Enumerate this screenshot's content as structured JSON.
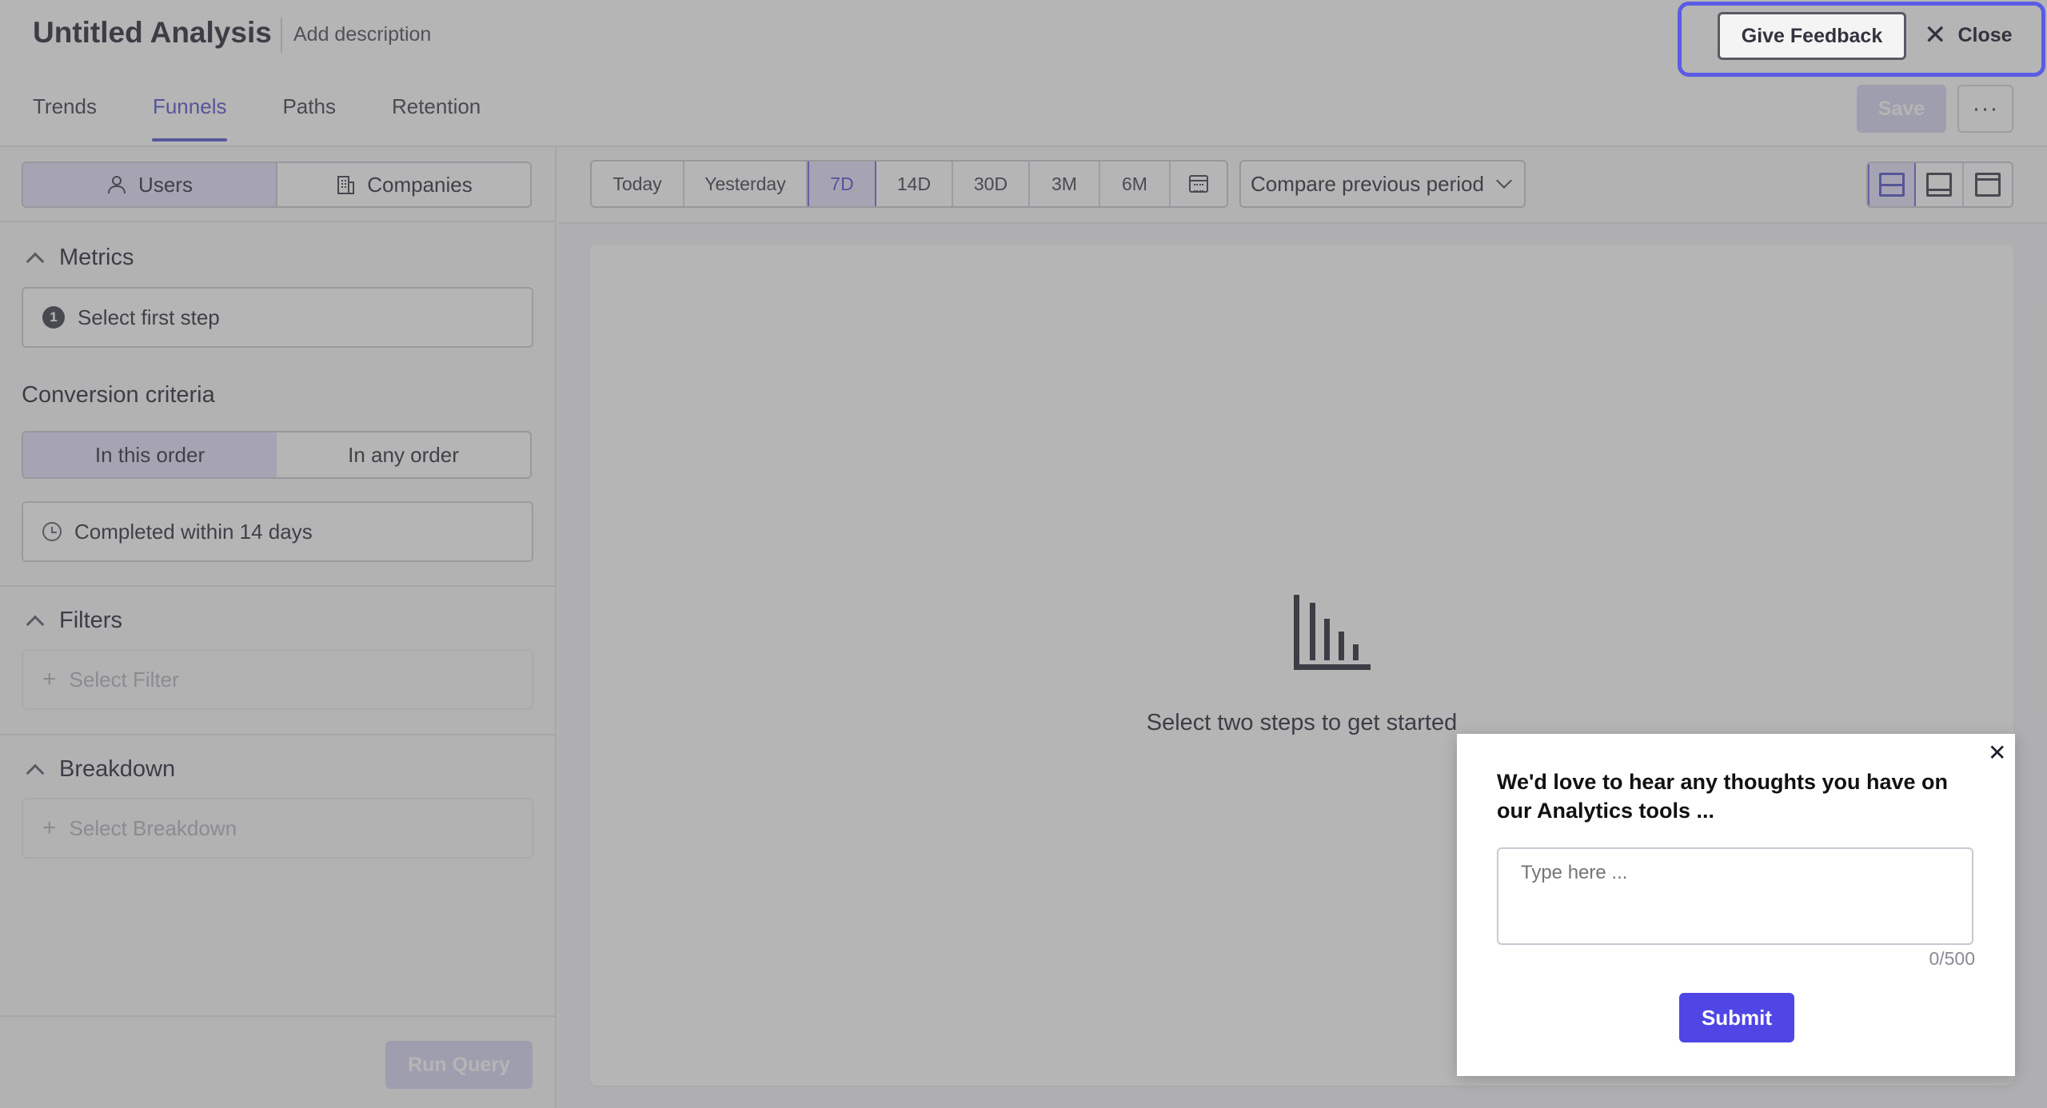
{
  "header": {
    "title": "Untitled Analysis",
    "add_description": "Add description",
    "tabs": [
      {
        "label": "Trends",
        "active": false
      },
      {
        "label": "Funnels",
        "active": true
      },
      {
        "label": "Paths",
        "active": false
      },
      {
        "label": "Retention",
        "active": false
      }
    ],
    "save_label": "Save",
    "more_label": "···",
    "give_feedback_label": "Give Feedback",
    "close_label": "Close"
  },
  "sidebar": {
    "entity_toggle": [
      {
        "label": "Users",
        "icon": "user-icon",
        "active": true
      },
      {
        "label": "Companies",
        "icon": "building-icon",
        "active": false
      }
    ],
    "metrics": {
      "heading": "Metrics",
      "first_step_number": "1",
      "first_step_label": "Select first step"
    },
    "conversion": {
      "heading": "Conversion criteria",
      "order_options": [
        {
          "label": "In this order",
          "active": true
        },
        {
          "label": "In any order",
          "active": false
        }
      ],
      "window_label": "Completed within 14 days"
    },
    "filters": {
      "heading": "Filters",
      "placeholder": "Select Filter"
    },
    "breakdown": {
      "heading": "Breakdown",
      "placeholder": "Select Breakdown"
    },
    "run_query_label": "Run Query"
  },
  "toolbar": {
    "date_ranges": [
      {
        "label": "Today",
        "active": false
      },
      {
        "label": "Yesterday",
        "active": false
      },
      {
        "label": "7D",
        "active": true
      },
      {
        "label": "14D",
        "active": false
      },
      {
        "label": "30D",
        "active": false
      },
      {
        "label": "3M",
        "active": false
      },
      {
        "label": "6M",
        "active": false
      }
    ],
    "calendar_icon": "calendar-icon",
    "compare_label": "Compare previous period"
  },
  "main": {
    "empty_state_icon": "bar-chart-icon",
    "empty_state_text": "Select two steps to get started"
  },
  "feedback_popup": {
    "title": "We'd love to hear any thoughts you have on our Analytics tools ...",
    "placeholder": "Type here ...",
    "char_count": "0/500",
    "submit_label": "Submit"
  },
  "colors": {
    "accent": "#5151c8",
    "highlight_outline": "#5b5be6",
    "submit": "#4f46e5",
    "overlay": "rgba(90,90,90,0.45)"
  }
}
